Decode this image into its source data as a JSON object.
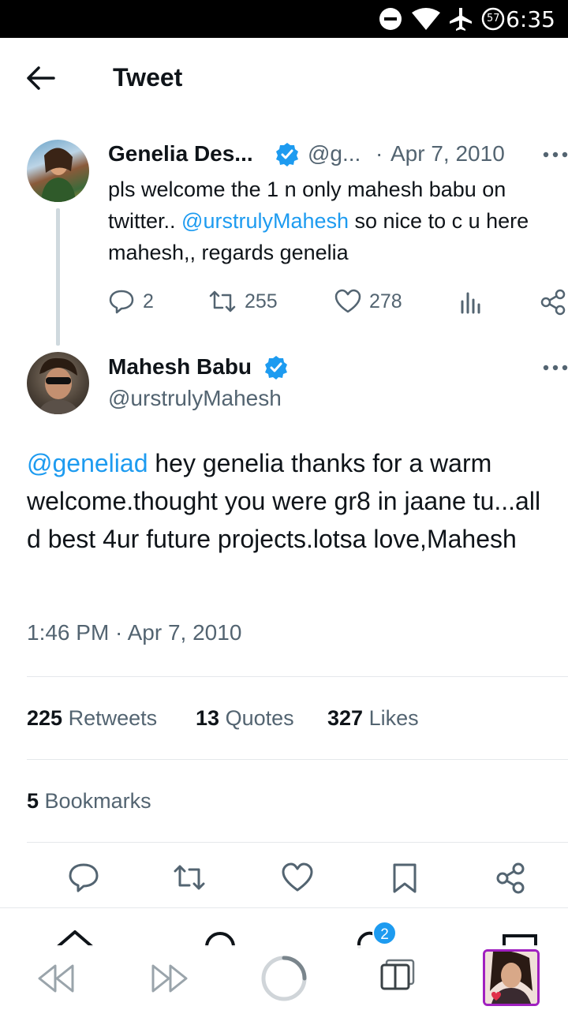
{
  "status_bar": {
    "time": "6:35",
    "battery_level": "57"
  },
  "header": {
    "title": "Tweet"
  },
  "parent_tweet": {
    "name": "Genelia Des...",
    "handle": "@g...",
    "separator": "·",
    "date": "Apr 7, 2010",
    "text_before": "pls welcome the 1 n only mahesh babu on twitter.. ",
    "mention": "@urstrulyMahesh",
    "text_after": " so nice to c u here mahesh,, regards genelia",
    "replies": "2",
    "retweets": "255",
    "likes": "278"
  },
  "main_tweet": {
    "name": "Mahesh Babu",
    "handle": "@urstrulyMahesh",
    "mention": "@geneliad",
    "text": " hey genelia thanks for a warm welcome.thought you were gr8 in jaane tu...all d best 4ur future projects.lotsa love,Mahesh",
    "timestamp": "1:46 PM · Apr 7, 2010"
  },
  "stats": {
    "retweets_count": "225",
    "retweets_label": "Retweets",
    "quotes_count": "13",
    "quotes_label": "Quotes",
    "likes_count": "327",
    "likes_label": "Likes",
    "bookmarks_count": "5",
    "bookmarks_label": "Bookmarks"
  },
  "nav": {
    "notifications_badge": "2"
  },
  "colors": {
    "accent": "#1d9bf0",
    "text": "#0f1419",
    "muted": "#536471"
  }
}
